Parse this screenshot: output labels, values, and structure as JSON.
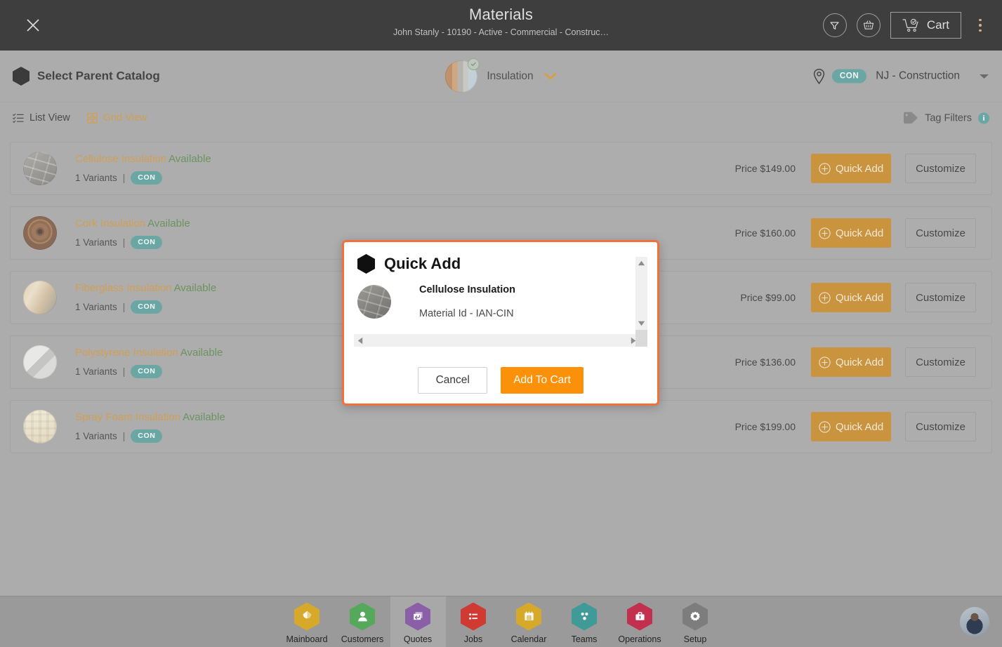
{
  "header": {
    "title": "Materials",
    "subtitle": "John Stanly - 10190 - Active - Commercial - Construc…",
    "close_label": "close-icon",
    "filter_label": "filter-icon",
    "basket_label": "basket-icon",
    "cart_label": "Cart",
    "menu_label": "more-options"
  },
  "catalog_bar": {
    "parent_catalog_label": "Select Parent Catalog",
    "selected_catalog": "Insulation",
    "location_badge": "CON",
    "location_label": "NJ - Construction"
  },
  "view_row": {
    "list_view_label": "List View",
    "grid_view_label": "Grid View",
    "tag_filters_label": "Tag Filters",
    "info_char": "i"
  },
  "list": {
    "price_prefix": "Price ",
    "quick_add_label": "Quick Add",
    "customize_label": "Customize",
    "variants_label": "1 Variants",
    "separator": "|",
    "tag": "CON",
    "status": "Available",
    "items": [
      {
        "name": "Cellulose Insulation",
        "status": "Available",
        "variants": "1 Variants",
        "tag": "CON",
        "price": "Price $149.00",
        "thumb": "th-cellulose"
      },
      {
        "name": "Cork Insulation",
        "status": "Available",
        "variants": "1 Variants",
        "tag": "CON",
        "price": "Price $160.00",
        "thumb": "th-cork"
      },
      {
        "name": "Fiberglass Insulation",
        "status": "Available",
        "variants": "1 Variants",
        "tag": "CON",
        "price": "Price $99.00",
        "thumb": "th-fiber"
      },
      {
        "name": "Polystyrene Insulation",
        "status": "Available",
        "variants": "1 Variants",
        "tag": "CON",
        "price": "Price $136.00",
        "thumb": "th-poly"
      },
      {
        "name": "Spray Foam Insulation",
        "status": "Available",
        "variants": "1 Variants",
        "tag": "CON",
        "price": "Price $199.00",
        "thumb": "th-spray"
      }
    ]
  },
  "modal": {
    "title": "Quick Add",
    "item_name": "Cellulose Insulation",
    "item_id": "Material Id - IAN-CIN",
    "cancel_label": "Cancel",
    "add_to_cart_label": "Add To Cart"
  },
  "bottom_nav": {
    "items": [
      {
        "label": "Mainboard",
        "color": "#d6a92b",
        "icon": "mainboard-icon",
        "selected": false
      },
      {
        "label": "Customers",
        "color": "#56a85a",
        "icon": "customers-icon",
        "selected": false
      },
      {
        "label": "Quotes",
        "color": "#8b5ea8",
        "icon": "quotes-icon",
        "selected": true
      },
      {
        "label": "Jobs",
        "color": "#cf3a33",
        "icon": "jobs-icon",
        "selected": false
      },
      {
        "label": "Calendar",
        "color": "#d6a92b",
        "icon": "calendar-icon",
        "selected": false
      },
      {
        "label": "Teams",
        "color": "#3f9a98",
        "icon": "teams-icon",
        "selected": false
      },
      {
        "label": "Operations",
        "color": "#c3304f",
        "icon": "operations-icon",
        "selected": false
      },
      {
        "label": "Setup",
        "color": "#7d7d7d",
        "icon": "setup-icon",
        "selected": false
      }
    ]
  },
  "colors": {
    "accent_orange": "#fb9108",
    "quick_add": "#bf7d15",
    "teal": "#4a9490",
    "modal_border": "#f4703a",
    "page_bg": "#9a9a9a",
    "topbar_bg": "#141414"
  }
}
